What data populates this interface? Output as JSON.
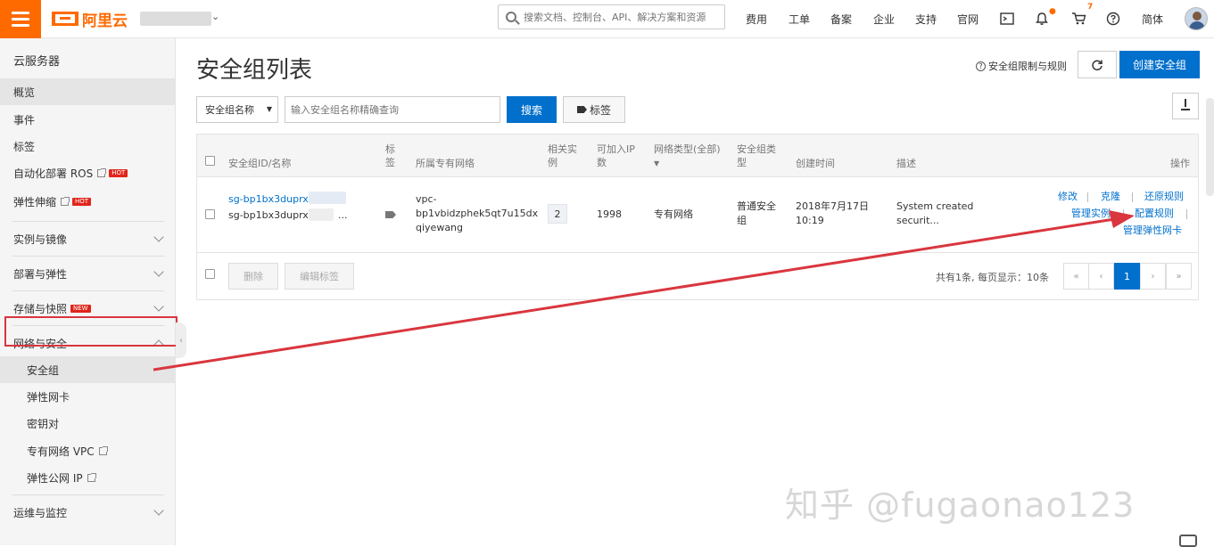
{
  "header": {
    "brand": "阿里云",
    "search_placeholder": "搜索文档、控制台、API、解决方案和资源",
    "nav": [
      "费用",
      "工单",
      "备案",
      "企业",
      "支持",
      "官网"
    ],
    "cart_count": "7",
    "language": "简体"
  },
  "sidebar": {
    "title": "云服务器",
    "top_items": [
      {
        "label": "概览"
      },
      {
        "label": "事件"
      },
      {
        "label": "标签"
      },
      {
        "label": "自动化部署 ROS",
        "tag": "HOT"
      },
      {
        "label": "弹性伸缩",
        "tag": "HOT"
      }
    ],
    "groups": [
      {
        "label": "实例与镜像"
      },
      {
        "label": "部署与弹性"
      },
      {
        "label": "存储与快照",
        "tag": "NEW"
      },
      {
        "label": "网络与安全"
      }
    ],
    "network_items": [
      {
        "label": "安全组"
      },
      {
        "label": "弹性网卡"
      },
      {
        "label": "密钥对"
      },
      {
        "label": "专有网络 VPC"
      },
      {
        "label": "弹性公网 IP"
      }
    ],
    "ops_group": "运维与监控"
  },
  "main": {
    "title": "安全组列表",
    "help_link": "安全组限制与规则",
    "create_button": "创建安全组",
    "filter_select": "安全组名称",
    "filter_placeholder": "输入安全组名称精确查询",
    "search_button": "搜索",
    "tag_button": "标签"
  },
  "table": {
    "headers": {
      "id_name": "安全组ID/名称",
      "tag": "标签",
      "vpc": "所属专有网络",
      "related": "相关实例",
      "ip": "可加入IP数",
      "network_type": "网络类型(全部)",
      "sg_type": "安全组类型",
      "created": "创建时间",
      "desc": "描述",
      "actions": "操作"
    },
    "row": {
      "id": "sg-bp1bx3duprxg",
      "name": "sg-bp1bx3duprxg",
      "name_suffix": "...",
      "vpc_line1": "vpc-",
      "vpc_line2": "bp1vbidzphek5qt7u15dx",
      "vpc_line3": "qiyewang",
      "related_count": "2",
      "ip_count": "1998",
      "network_type": "专有网络",
      "sg_type_line1": "普通安全",
      "sg_type_line2": "组",
      "created_line1": "2018年7月17日",
      "created_line2": "10:19",
      "desc_line1": "System created",
      "desc_line2": "securit...",
      "actions": {
        "modify": "修改",
        "clone": "克隆",
        "restore": "还原规则",
        "manage_instances": "管理实例",
        "config_rules": "配置规则",
        "manage_eni": "管理弹性网卡"
      }
    },
    "footer": {
      "delete": "删除",
      "edit_tags": "编辑标签",
      "summary": "共有1条, 每页显示：10条",
      "current_page": "1"
    }
  },
  "watermark": "知乎 @fugaonao123",
  "colors": {
    "brand": "#ff6a00",
    "primary": "#0070cc",
    "annotation": "#d9363e"
  }
}
